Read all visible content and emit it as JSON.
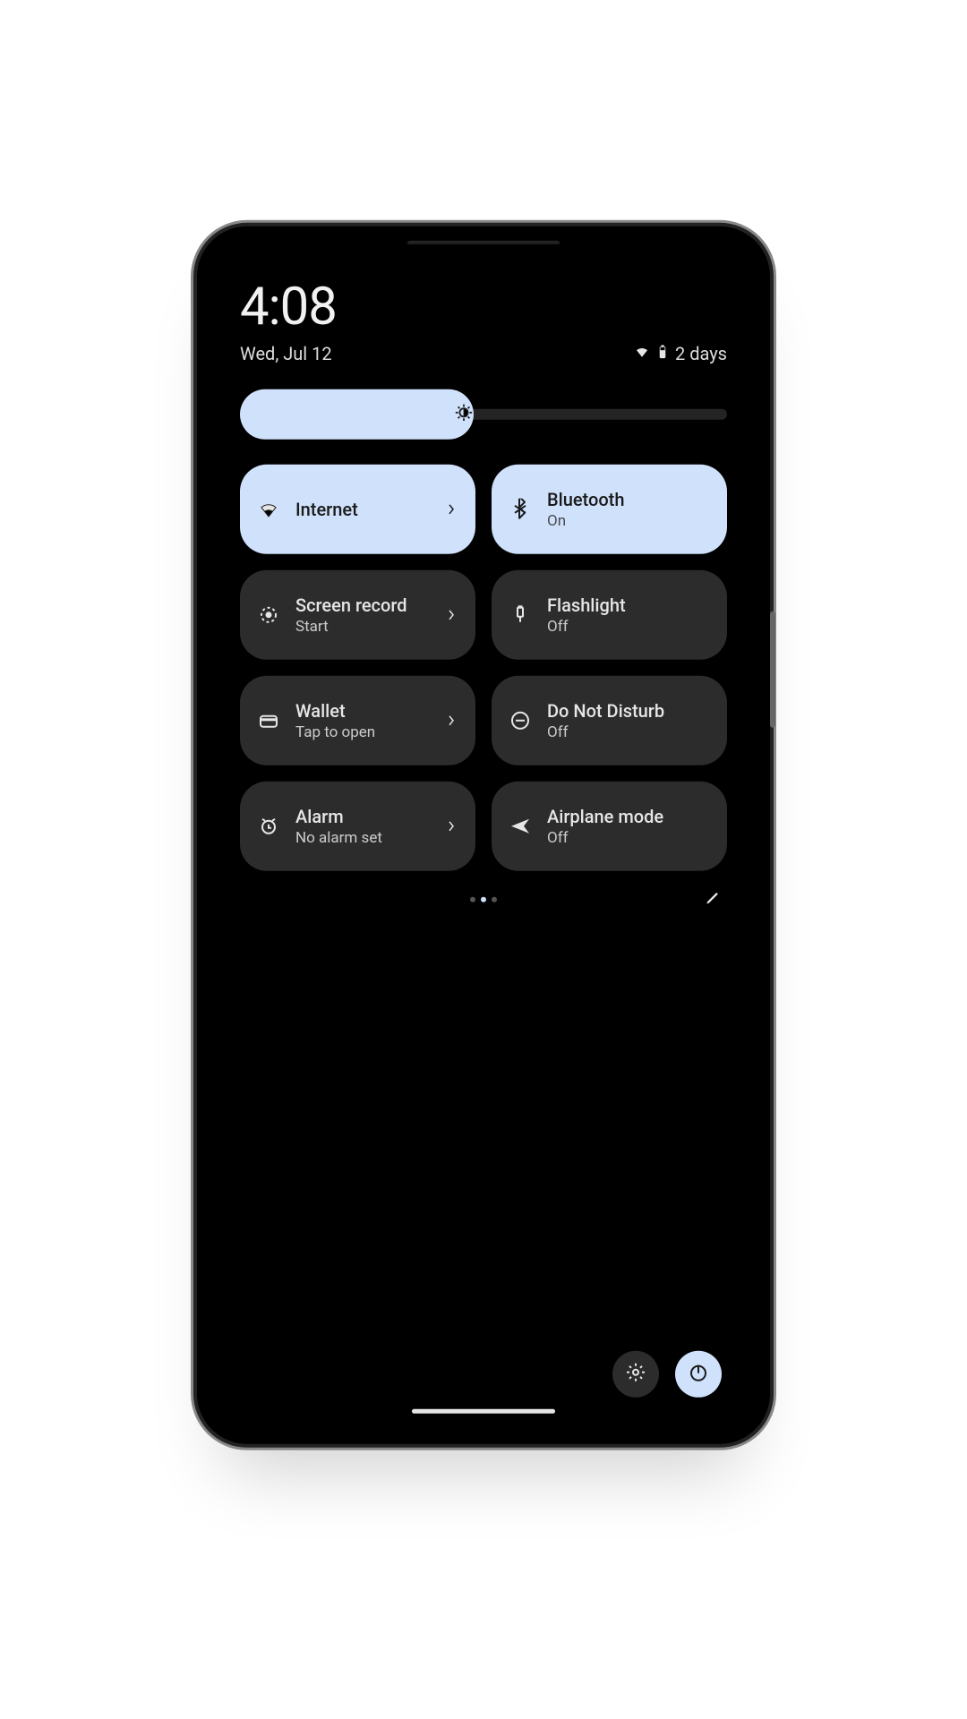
{
  "header": {
    "time": "4:08",
    "date": "Wed, Jul 12",
    "battery_text": "2 days"
  },
  "brightness": {
    "percent": 48
  },
  "tiles": [
    {
      "id": "internet",
      "title": "Internet",
      "sub": "",
      "state": "on",
      "chevron": true
    },
    {
      "id": "bluetooth",
      "title": "Bluetooth",
      "sub": "On",
      "state": "on",
      "chevron": false
    },
    {
      "id": "record",
      "title": "Screen record",
      "sub": "Start",
      "state": "off",
      "chevron": true
    },
    {
      "id": "flash",
      "title": "Flashlight",
      "sub": "Off",
      "state": "off",
      "chevron": false
    },
    {
      "id": "wallet",
      "title": "Wallet",
      "sub": "Tap to open",
      "state": "off",
      "chevron": true
    },
    {
      "id": "dnd",
      "title": "Do Not Disturb",
      "sub": "Off",
      "state": "off",
      "chevron": false
    },
    {
      "id": "alarm",
      "title": "Alarm",
      "sub": "No alarm set",
      "state": "off",
      "chevron": true
    },
    {
      "id": "airplane",
      "title": "Airplane mode",
      "sub": "Off",
      "state": "off",
      "chevron": false
    }
  ],
  "pager": {
    "pages": 3,
    "active": 1
  },
  "colors": {
    "accent": "#cfe1fb",
    "tile_off": "#2c2c2c",
    "bg": "#000000"
  }
}
